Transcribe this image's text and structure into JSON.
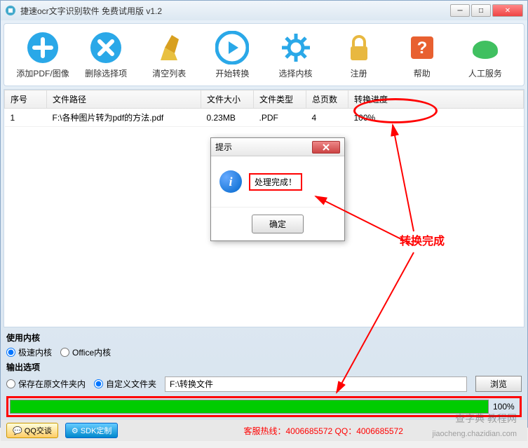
{
  "window": {
    "title": "捷速ocr文字识别软件 免费试用版 v1.2"
  },
  "toolbar": [
    {
      "label": "添加PDF/图像",
      "icon": "add",
      "color": "#2aa8e8"
    },
    {
      "label": "删除选择项",
      "icon": "delete",
      "color": "#2aa8e8"
    },
    {
      "label": "清空列表",
      "icon": "clear",
      "color": "#d8a020"
    },
    {
      "label": "开始转换",
      "icon": "play",
      "color": "#2aa8e8"
    },
    {
      "label": "选择内核",
      "icon": "gear",
      "color": "#2aa8e8"
    },
    {
      "label": "注册",
      "icon": "lock",
      "color": "#e8b840"
    },
    {
      "label": "帮助",
      "icon": "help",
      "color": "#e86030"
    },
    {
      "label": "人工服务",
      "icon": "phone",
      "color": "#40c060"
    }
  ],
  "table": {
    "headers": [
      "序号",
      "文件路径",
      "文件大小",
      "文件类型",
      "总页数",
      "转换进度"
    ],
    "rows": [
      {
        "seq": "1",
        "path": "F:\\各种图片转为pdf的方法.pdf",
        "size": "0.23MB",
        "type": ".PDF",
        "pages": "4",
        "progress": "100%"
      }
    ]
  },
  "dialog": {
    "title": "提示",
    "message": "处理完成！",
    "ok": "确定"
  },
  "options": {
    "kernel_label": "使用内核",
    "kernel_fast": "极速内核",
    "kernel_office": "Office内核",
    "output_label": "输出选项",
    "output_keep": "保存在原文件夹内",
    "output_custom": "自定义文件夹",
    "output_path": "F:\\转换文件",
    "browse": "浏览"
  },
  "progress": {
    "text": "100%"
  },
  "bottom": {
    "qq": "QQ交谈",
    "sdk": "SDK定制",
    "hotline": "客服热线：4006685572 QQ：4006685572"
  },
  "annotations": {
    "done": "转换完成"
  },
  "watermarks": {
    "name": "查字典  教程网",
    "url": "jiaocheng.chazidian.com"
  }
}
